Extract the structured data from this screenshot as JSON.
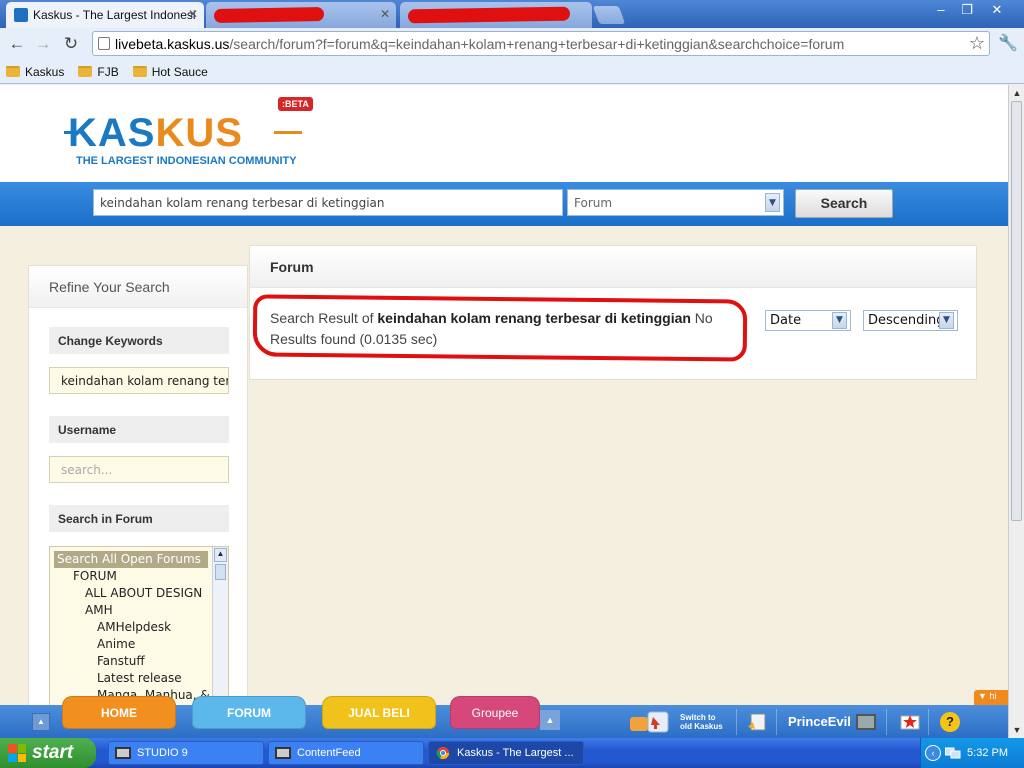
{
  "browser": {
    "tabs": [
      {
        "title": "Kaskus - The Largest Indonesi",
        "active": true
      },
      {
        "title": "",
        "active": false
      },
      {
        "title": "",
        "active": false
      }
    ],
    "window_controls": {
      "minimize": "–",
      "restore": "❐",
      "close": "✕"
    },
    "address": {
      "host": "livebeta.kaskus.us",
      "path": "/search/forum?f=forum&q=keindahan+kolam+renang+terbesar+di+ketinggian&searchchoice=forum"
    },
    "bookmarks": [
      "Kaskus",
      "FJB",
      "Hot Sauce"
    ]
  },
  "site": {
    "logo_text_a": "KAS",
    "logo_text_b": "KUS",
    "tagline": "THE LARGEST INDONESIAN COMMUNITY",
    "beta_badge": ":BETA"
  },
  "search": {
    "query": "keindahan kolam renang terbesar di ketinggian",
    "scope": "Forum",
    "button": "Search"
  },
  "sidebar": {
    "title": "Refine Your Search",
    "change_keywords_label": "Change Keywords",
    "keywords_value": "keindahan kolam renang terb",
    "username_label": "Username",
    "username_placeholder": "search...",
    "search_in_forum_label": "Search in Forum",
    "forums": [
      {
        "label": "Search All Open Forums",
        "level": 0,
        "selected": true
      },
      {
        "label": "FORUM",
        "level": 1,
        "selected": false
      },
      {
        "label": "ALL ABOUT DESIGN",
        "level": 2,
        "selected": false
      },
      {
        "label": "AMH",
        "level": 2,
        "selected": false
      },
      {
        "label": "AMHelpdesk",
        "level": 3,
        "selected": false
      },
      {
        "label": "Anime",
        "level": 3,
        "selected": false
      },
      {
        "label": "Fanstuff",
        "level": 3,
        "selected": false
      },
      {
        "label": "Latest release",
        "level": 3,
        "selected": false
      },
      {
        "label": "Manga, Manhua, &",
        "level": 3,
        "selected": false
      }
    ]
  },
  "main": {
    "title": "Forum",
    "result_prefix": "Search Result of ",
    "result_query": "keindahan kolam renang terbesar di ketinggian",
    "result_suffix": " No Results found (0.0135 sec)",
    "sort_by": "Date",
    "sort_order": "Descending"
  },
  "bottom_nav": {
    "tabs": [
      {
        "label": "HOME",
        "color": "#f1901f"
      },
      {
        "label": "FORUM",
        "color": "#5cb7ea"
      },
      {
        "label": "JUAL BELI",
        "color": "#f1c21b"
      },
      {
        "label": "Groupee",
        "color": "#d6487a"
      }
    ],
    "switch_label_line1": "Switch to",
    "switch_label_line2": "old Kaskus",
    "username": "PrinceEvil",
    "hide_label": "▼ hi"
  },
  "taskbar": {
    "start_label": "start",
    "tasks": [
      {
        "label": "STUDIO 9",
        "active": false
      },
      {
        "label": "ContentFeed",
        "active": false
      },
      {
        "label": "Kaskus - The Largest ...",
        "active": true
      }
    ],
    "clock": "5:32 PM"
  },
  "colors": {
    "kaskus_blue": "#1b79c4",
    "kaskus_orange": "#e98a1f",
    "redline": "#e01010"
  }
}
